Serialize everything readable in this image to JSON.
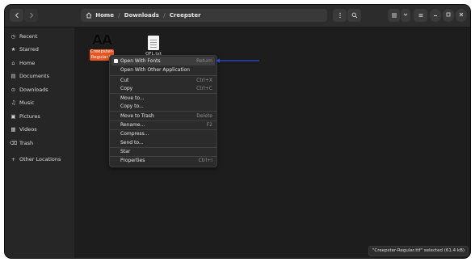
{
  "header": {
    "breadcrumbs": [
      "Home",
      "Downloads",
      "Creepster"
    ],
    "separator": "/"
  },
  "sidebar": {
    "items": [
      {
        "label": "Recent",
        "icon": "clock-icon"
      },
      {
        "label": "Starred",
        "icon": "star-icon"
      },
      {
        "label": "Home",
        "icon": "home-icon"
      },
      {
        "label": "Documents",
        "icon": "document-icon"
      },
      {
        "label": "Downloads",
        "icon": "download-icon"
      },
      {
        "label": "Music",
        "icon": "music-icon"
      },
      {
        "label": "Pictures",
        "icon": "picture-icon"
      },
      {
        "label": "Videos",
        "icon": "video-icon"
      },
      {
        "label": "Trash",
        "icon": "trash-icon"
      },
      {
        "label": "Other Locations",
        "icon": "plus-icon"
      }
    ]
  },
  "files": [
    {
      "name_line1": "Creepster-",
      "name_line2": "Regular.tt",
      "preview_text": "AA",
      "selected": true
    },
    {
      "name": "OFL.txt",
      "selected": false
    }
  ],
  "context_menu": {
    "items": [
      {
        "label": "Open With Fonts",
        "accel": "Return",
        "highlighted": true
      },
      {
        "label": "Open With Other Application",
        "accel": ""
      },
      {
        "label": "Cut",
        "accel": "Ctrl+X"
      },
      {
        "label": "Copy",
        "accel": "Ctrl+C"
      },
      {
        "label": "Move to...",
        "accel": ""
      },
      {
        "label": "Copy to...",
        "accel": ""
      },
      {
        "label": "Move to Trash",
        "accel": "Delete"
      },
      {
        "label": "Rename...",
        "accel": "F2"
      },
      {
        "label": "Compress...",
        "accel": ""
      },
      {
        "label": "Send to...",
        "accel": ""
      },
      {
        "label": "Star",
        "accel": ""
      },
      {
        "label": "Properties",
        "accel": "Ctrl+I"
      }
    ]
  },
  "status_bar": {
    "text": "\"Creepster-Regular.ttf\" selected (61.4 kB)"
  },
  "colors": {
    "selection": "#e95420",
    "annotation_arrow": "#2a4bd7",
    "window_bg": "#1d1d1d"
  }
}
